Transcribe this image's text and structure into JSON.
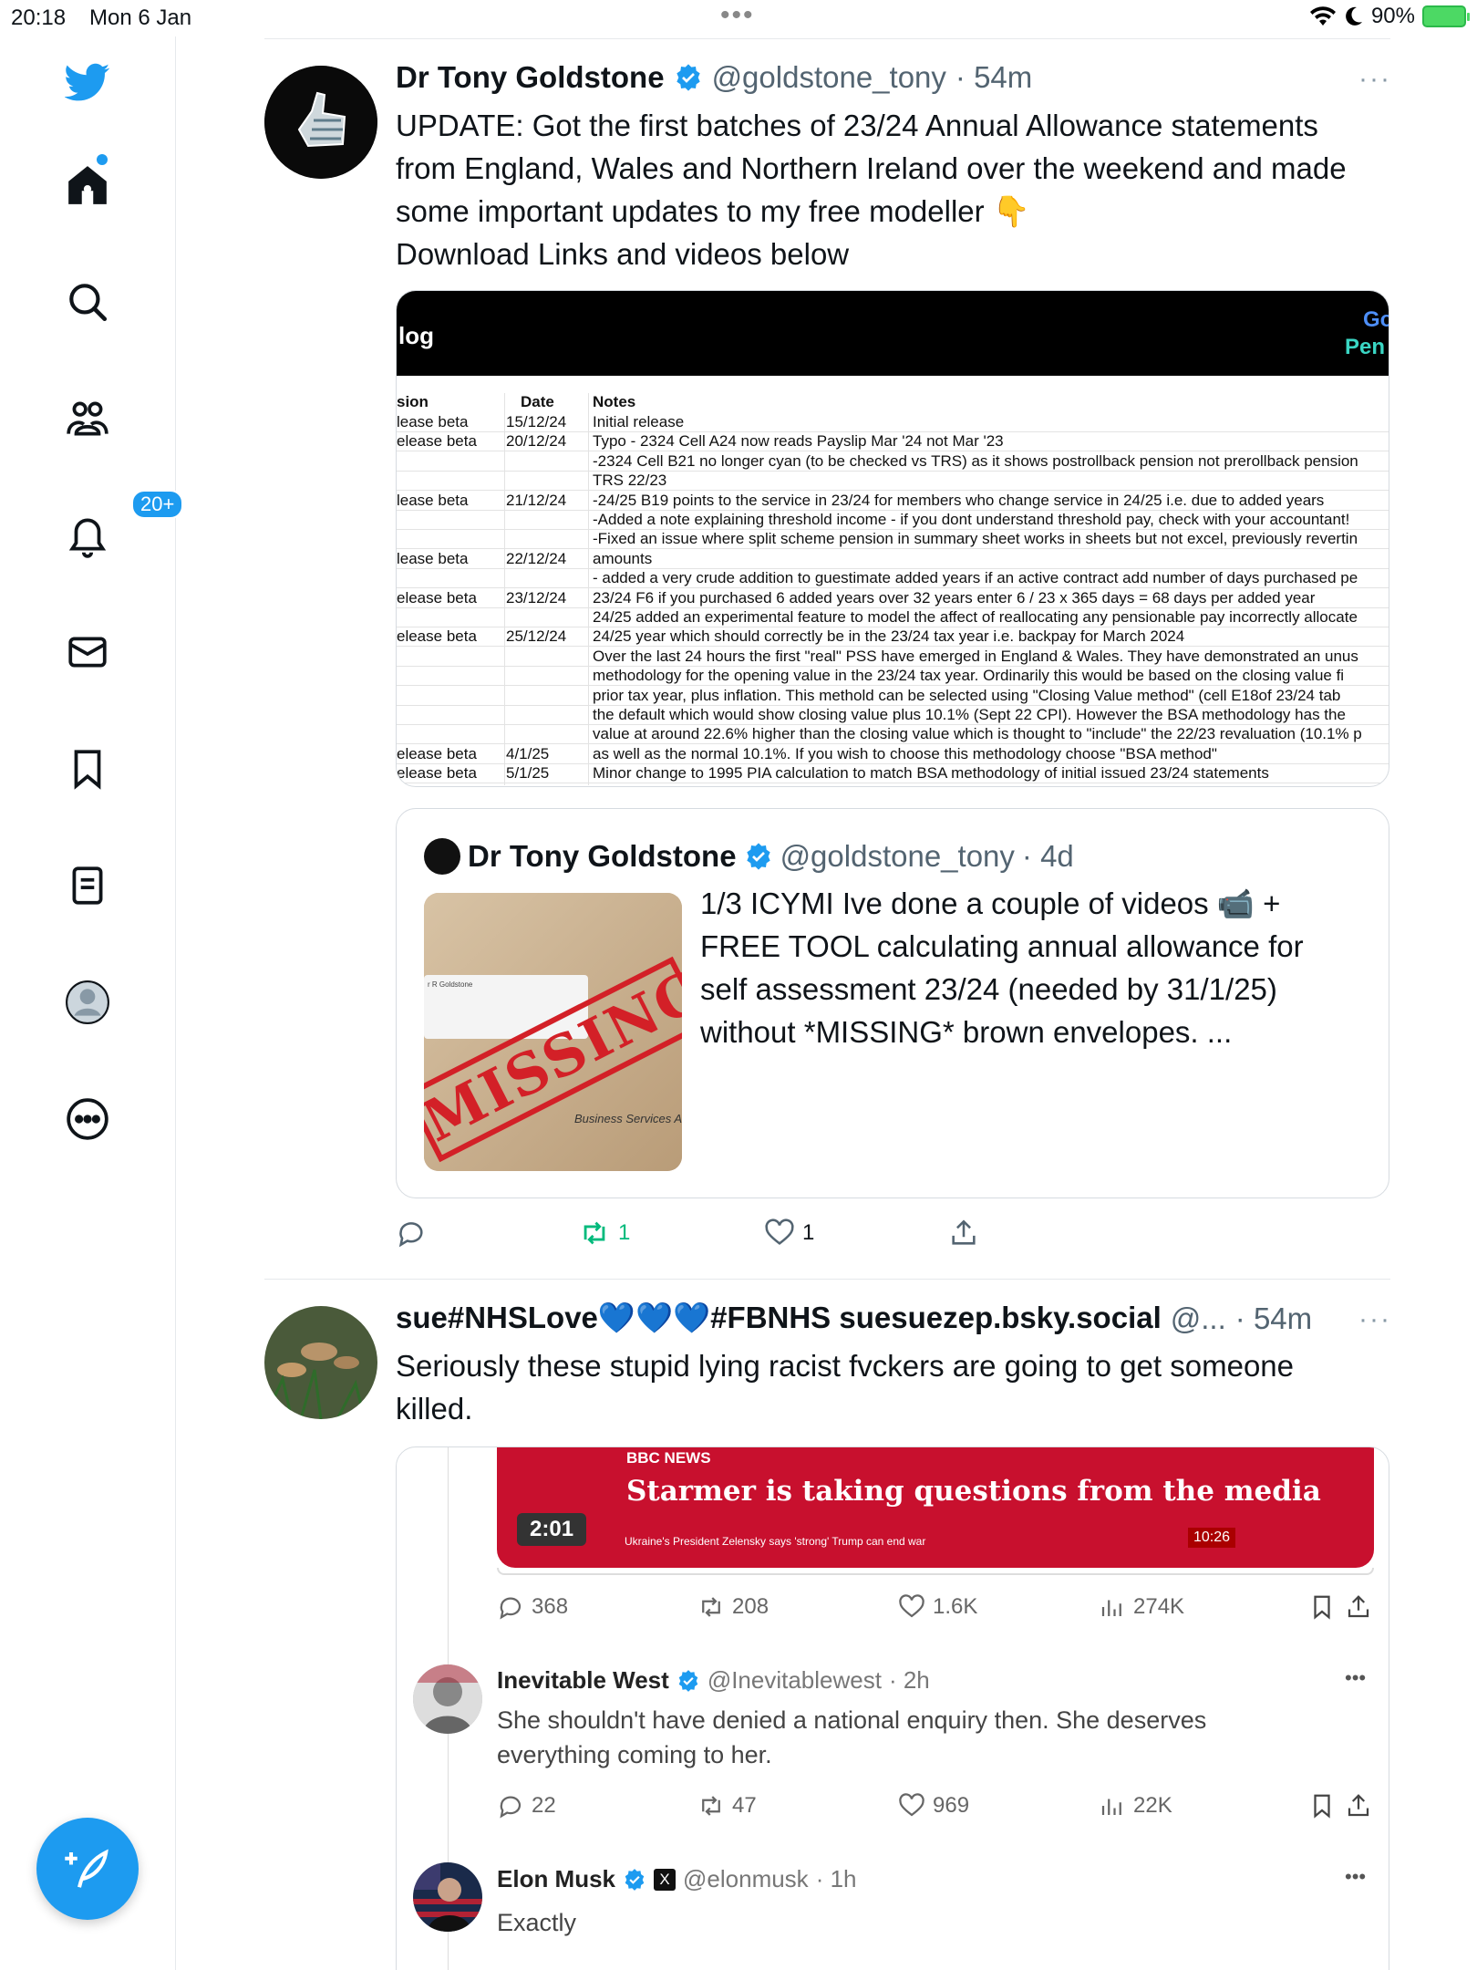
{
  "status_bar": {
    "time": "20:18",
    "date": "Mon 6 Jan",
    "battery": "90%"
  },
  "sidebar": {
    "notifications_badge": "20+"
  },
  "tweet1": {
    "name": "Dr Tony Goldstone",
    "handle": "@goldstone_tony",
    "time": "· 54m",
    "more": "···",
    "text_lines": [
      "UPDATE: Got the first batches of 23/24 Annual Allowance statements",
      "from England, Wales and Northern Ireland over the weekend and made",
      "some important updates to my free modeller 👇",
      "Download Links and videos below"
    ],
    "image": {
      "header_title": "log",
      "header_logo_1": "Go",
      "header_logo_2": "Pen",
      "col_headers": [
        "sion",
        "Date",
        "Notes"
      ],
      "rows": [
        {
          "v": "lease beta",
          "d": "15/12/24",
          "n": "Initial release"
        },
        {
          "v": "elease beta",
          "d": "20/12/24",
          "n": "Typo - 2324 Cell A24 now reads Payslip Mar '24 not Mar '23"
        },
        {
          "v": "",
          "d": "",
          "n": "-2324 Cell B21 no longer cyan (to be checked vs TRS) as it shows postrollback pension not prerollback pension"
        },
        {
          "v": "",
          "d": "",
          "n": "TRS 22/23"
        },
        {
          "v": "lease beta",
          "d": "21/12/24",
          "n": "-24/25 B19 points to the service in 23/24 for members who change service in 24/25 i.e. due to added years"
        },
        {
          "v": "",
          "d": "",
          "n": "-Added a note explaining threshold income - if you dont understand threshold pay, check with your accountant!"
        },
        {
          "v": "",
          "d": "",
          "n": "-Fixed an issue where split scheme pension in summary sheet works in sheets but not excel, previously revertin"
        },
        {
          "v": "lease beta",
          "d": "22/12/24",
          "n": "amounts"
        },
        {
          "v": "",
          "d": "",
          "n": "- added a very crude addition to guestimate added years if an active contract add number of days purchased pe"
        },
        {
          "v": "elease beta",
          "d": "23/12/24",
          "n": "23/24 F6 if you purchased 6 added years over 32 years enter 6 / 23 x 365 days = 68 days per added year"
        },
        {
          "v": "",
          "d": "",
          "n": "24/25 added an experimental feature to model the affect of reallocating any pensionable pay incorrectly allocate"
        },
        {
          "v": "elease beta",
          "d": "25/12/24",
          "n": "24/25 year which should correctly be in the 23/24 tax year i.e. backpay for March 2024"
        },
        {
          "v": "",
          "d": "",
          "n": "Over the last 24 hours the first \"real\" PSS have emerged in England & Wales. They have demonstrated an unus"
        },
        {
          "v": "",
          "d": "",
          "n": "methodology for the opening value in the 23/24 tax year. Ordinarily this would be based on the closing value fi"
        },
        {
          "v": "",
          "d": "",
          "n": "prior tax year, plus inflation. This methold can be selected using \"Closing Value method\" (cell E18of 23/24 tab"
        },
        {
          "v": "",
          "d": "",
          "n": "the default which would show closing value plus 10.1% (Sept 22 CPI). However the BSA methodology has the"
        },
        {
          "v": "",
          "d": "",
          "n": "value at around 22.6% higher than the closing value which is thought to \"include\" the 22/23 revaluation (10.1% p"
        },
        {
          "v": "elease beta",
          "d": "4/1/25",
          "n": "as well as the normal 10.1%. If you wish to choose this methodology choose \"BSA method\""
        },
        {
          "v": "elease beta",
          "d": "5/1/25",
          "n": "Minor change to 1995 PIA calculation to match BSA methodology of initial issued 23/24 statements"
        }
      ]
    },
    "quote": {
      "name": "Dr Tony Goldstone",
      "handle": "@goldstone_tony",
      "time": "· 4d",
      "text_lines": [
        "1/3 ICYMI Ive done a couple of videos 📹 +",
        "FREE TOOL calculating annual allowance for",
        "self assessment 23/24 (needed by 31/1/25)",
        "without *MISSING* brown envelopes. ..."
      ],
      "image_stamp": "MISSING",
      "image_footer": "Business Services A",
      "image_label": "r R Goldstone"
    },
    "actions": {
      "reply": "",
      "retweet": "1",
      "like": "1"
    }
  },
  "tweet2": {
    "name": "sue#NHSLove💙💙💙#FBNHS suesuezep.bsky.social",
    "handle": "@...",
    "time": "· 54m",
    "more": "···",
    "text_lines": [
      "Seriously these stupid lying racist fvckers are going to get someone",
      "killed."
    ],
    "embed": {
      "video_channel": "BBC NEWS",
      "video_headline": "Starmer is taking questions from the media",
      "video_ticker": "Ukraine's President Zelensky says 'strong' Trump can end war",
      "video_clock": "10:26",
      "video_duration": "2:01",
      "stats": {
        "replies": "368",
        "retweets": "208",
        "likes": "1.6K",
        "views": "274K"
      },
      "reply1": {
        "name": "Inevitable West",
        "handle": "@Inevitablewest",
        "time": "· 2h",
        "text_lines": [
          "She shouldn't have denied a national enquiry then. She deserves",
          "everything coming to her."
        ],
        "stats": {
          "replies": "22",
          "retweets": "47",
          "likes": "969",
          "views": "22K"
        }
      },
      "reply2": {
        "name": "Elon Musk",
        "handle": "@elonmusk",
        "time": "· 1h",
        "text": "Exactly"
      }
    }
  },
  "colors": {
    "accent": "#1d9bf0",
    "retweet": "#00ba7c",
    "bbc_red": "#c8102e"
  }
}
